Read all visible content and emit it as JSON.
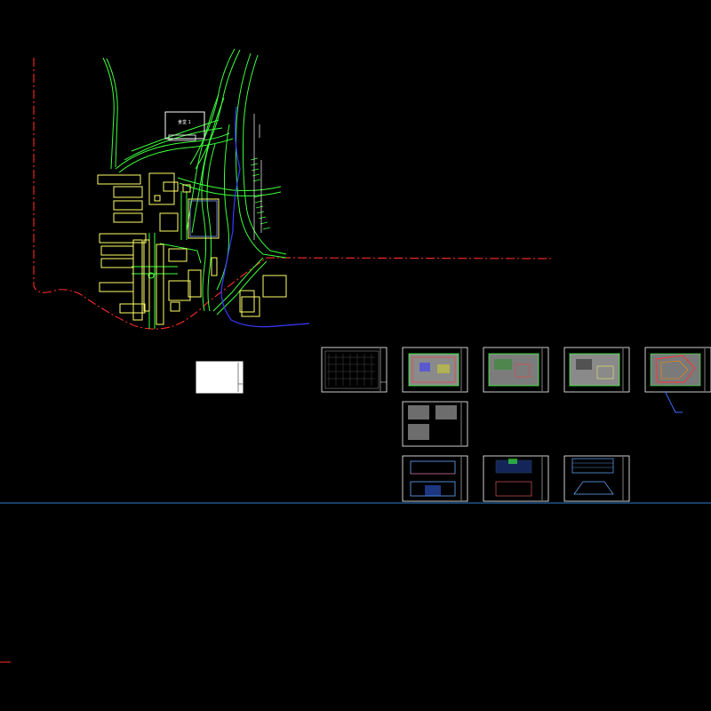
{
  "drawing": {
    "site_plan": {
      "building_label": "食堂 1"
    },
    "sheet_group_title": "",
    "colors": {
      "background": "#000000",
      "boundary": "#ff2a2a",
      "roads": "#3cff3c",
      "buildings": "#ffff66",
      "water": "#3a3aff",
      "sheet_border": "#ffffff",
      "model_line": "#2e7dd1"
    },
    "sheets": [
      {
        "name": "grid-sheet",
        "kind": "grid"
      },
      {
        "name": "floor-plan-1",
        "kind": "plan"
      },
      {
        "name": "floor-plan-2",
        "kind": "plan"
      },
      {
        "name": "floor-plan-3",
        "kind": "plan"
      },
      {
        "name": "roof-plan",
        "kind": "roof"
      },
      {
        "name": "detail-sheet",
        "kind": "details"
      },
      {
        "name": "elevation-1",
        "kind": "elevation"
      },
      {
        "name": "elevation-2",
        "kind": "elevation"
      },
      {
        "name": "elevation-3",
        "kind": "elevation"
      }
    ]
  }
}
